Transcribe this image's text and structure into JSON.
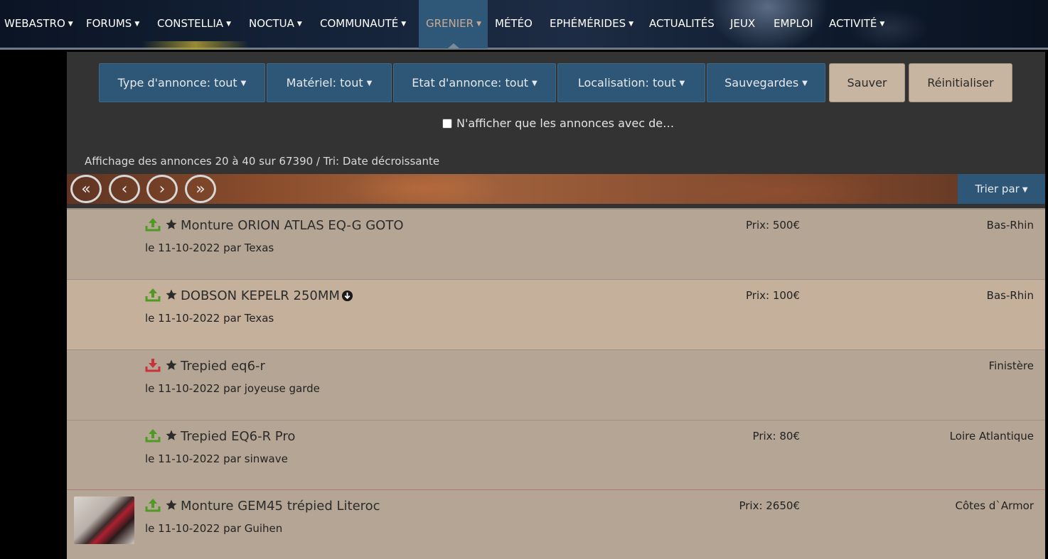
{
  "nav": {
    "items": [
      {
        "label": "WEBASTRO",
        "caret": true
      },
      {
        "label": "FORUMS",
        "caret": true
      },
      {
        "label": "CONSTELLIA",
        "caret": true
      },
      {
        "label": "NOCTUA",
        "caret": true
      },
      {
        "label": "COMMUNAUTÉ",
        "caret": true
      },
      {
        "label": "GRENIER",
        "caret": true,
        "active": true
      },
      {
        "label": "MÉTÉO",
        "caret": false
      },
      {
        "label": "EPHÉMÉRIDES",
        "caret": true
      },
      {
        "label": "ACTUALITÉS",
        "caret": false
      },
      {
        "label": "JEUX",
        "caret": false
      },
      {
        "label": "EMPLOI",
        "caret": false
      },
      {
        "label": "ACTIVITÉ",
        "caret": true
      }
    ]
  },
  "filters": {
    "type": "Type d'annonce: tout",
    "materiel": "Matériel: tout",
    "etat": "Etat d'annonce: tout",
    "localisation": "Localisation: tout",
    "sauvegardes": "Sauvegardes",
    "save_label": "Sauver",
    "reset_label": "Réinitialiser",
    "checkbox_label": "N'afficher que les annonces avec de…",
    "checkbox_checked": false
  },
  "summary": "Affichage des annonces 20 à 40 sur 67390 / Tri: Date décroissante",
  "pagination": {
    "first": "«",
    "prev": "‹",
    "next": "›",
    "last": "»",
    "sort_label": "Trier par"
  },
  "colors": {
    "nav_active_bg": "#2f5878",
    "filter_bg": "#2e5677",
    "action_bg": "#c7b5a2",
    "icon_up": "#4e9a22",
    "icon_down": "#c8333a"
  },
  "listings": [
    {
      "title": "Monture ORION ATLAS EQ-G GOTO",
      "meta": "le 11-10-2022 par Texas",
      "price": "Prix: 500€",
      "location": "Bas-Rhin",
      "status": "up-icon",
      "thumb": false,
      "dropdown": false
    },
    {
      "title": "DOBSON KEPELR 250MM",
      "meta": "le 11-10-2022 par Texas",
      "price": "Prix: 100€",
      "location": "Bas-Rhin",
      "status": "up-icon",
      "thumb": false,
      "dropdown": true
    },
    {
      "title": "Trepied eq6-r",
      "meta": "le 11-10-2022 par joyeuse garde",
      "price": "",
      "location": "Finistère",
      "status": "down-icon",
      "thumb": false,
      "dropdown": false
    },
    {
      "title": "Trepied EQ6-R Pro",
      "meta": "le 11-10-2022 par sinwave",
      "price": "Prix: 80€",
      "location": "Loire Atlantique",
      "status": "up-icon",
      "thumb": false,
      "dropdown": false
    },
    {
      "title": "Monture GEM45 trépied Literoc",
      "meta": "le 11-10-2022 par Guihen",
      "price": "Prix: 2650€",
      "location": "Côtes d`Armor",
      "status": "up-icon",
      "thumb": true,
      "dropdown": false
    }
  ]
}
